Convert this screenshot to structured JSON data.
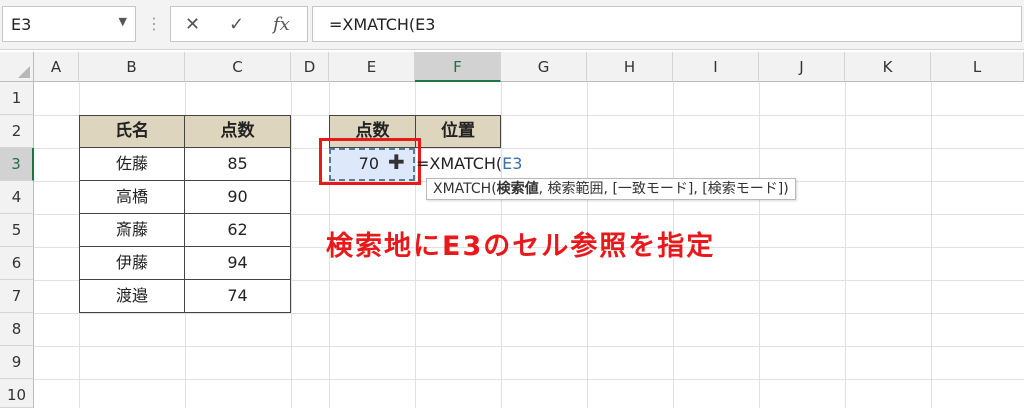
{
  "formula_bar": {
    "name_box": "E3",
    "name_box_arrow": "▼",
    "separator": "⋮",
    "cancel_icon": "✕",
    "enter_icon": "✓",
    "fx_label": "fx",
    "formula": "=XMATCH(E3"
  },
  "columns": [
    "A",
    "B",
    "C",
    "D",
    "E",
    "F",
    "G",
    "H",
    "I",
    "J",
    "K",
    "L"
  ],
  "rows": [
    "1",
    "2",
    "3",
    "4",
    "5",
    "6",
    "7",
    "8",
    "9",
    "10"
  ],
  "active_cell": {
    "column": "F",
    "row": "3"
  },
  "table1": {
    "headers": [
      "氏名",
      "点数"
    ],
    "rows": [
      [
        "佐藤",
        "85"
      ],
      [
        "高橋",
        "90"
      ],
      [
        "斎藤",
        "62"
      ],
      [
        "伊藤",
        "94"
      ],
      [
        "渡邉",
        "74"
      ]
    ]
  },
  "table2": {
    "headers": [
      "点数",
      "位置"
    ],
    "value": "70"
  },
  "cell_edit": {
    "prefix": "=XMATCH(",
    "ref": "E3"
  },
  "tooltip": {
    "func": "XMATCH(",
    "arg_bold": "検索値",
    "rest": ", 検索範囲, [一致モード], [検索モード])"
  },
  "annotation": "検索地にE3のセル参照を指定",
  "colors": {
    "accent_red": "#e8191b",
    "header_fill": "#ddd5bd",
    "selected_fill": "#dde8fb",
    "excel_green": "#217346"
  }
}
